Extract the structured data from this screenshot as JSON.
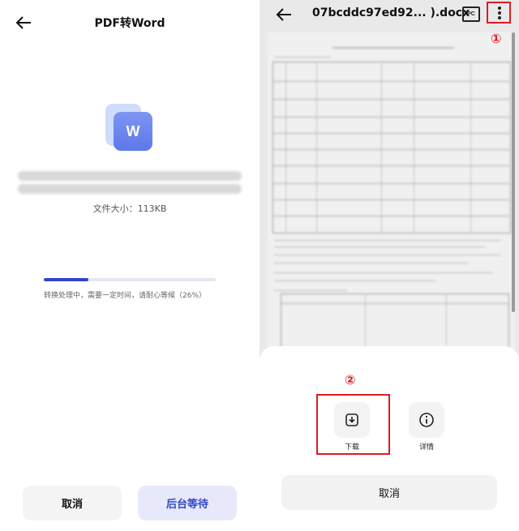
{
  "left": {
    "title": "PDF转Word",
    "file_icon_letter": "W",
    "file_size": "文件大小：113KB",
    "progress": {
      "percent": 26,
      "text": "转换处理中，需要一定时间，请耐心等候（26%）"
    },
    "buttons": {
      "cancel": "取消",
      "background": "后台等待"
    }
  },
  "right": {
    "title": "07bcddc97ed92... ).docx",
    "pc_label": "PC",
    "markers": {
      "one": "①",
      "two": "②"
    },
    "actions": {
      "download": "下载",
      "details": "详情"
    },
    "cancel": "取消"
  },
  "colors": {
    "accent": "#3344c8",
    "highlight": "#e01a22"
  }
}
